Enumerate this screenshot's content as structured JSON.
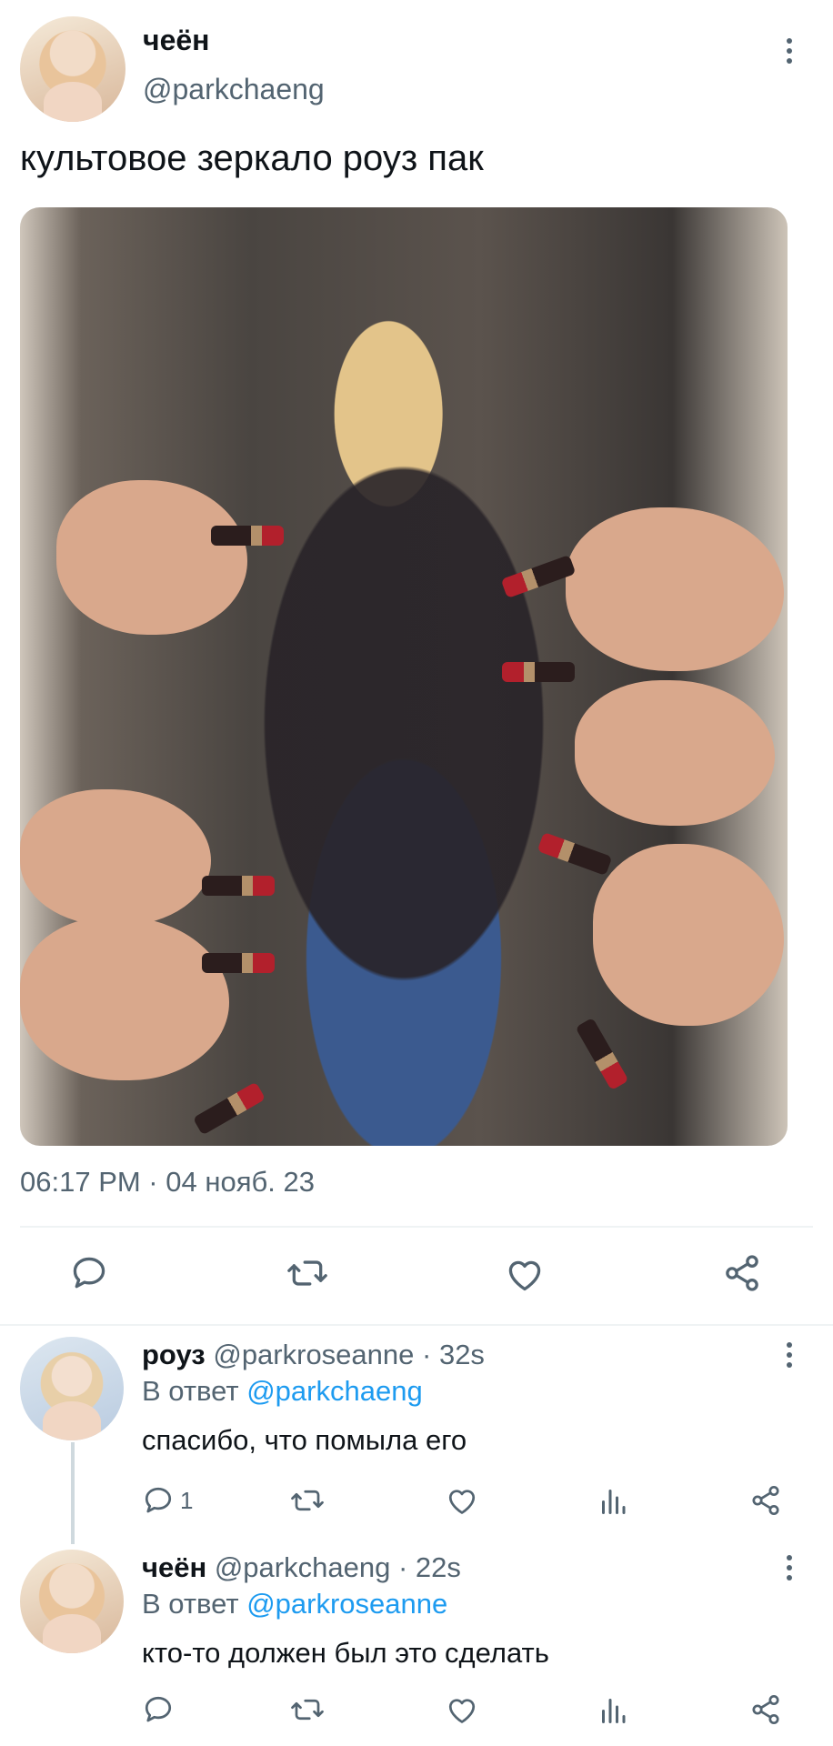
{
  "tweet": {
    "author_name": "чеён",
    "author_handle": "@parkchaeng",
    "text": "культовое зеркало роуз пак",
    "timestamp": "06:17 PM · 04 нояб. 23"
  },
  "replies": [
    {
      "author_name": "роуз",
      "author_handle": "@parkroseanne",
      "age": "· 32s",
      "reply_prefix": "В ответ",
      "reply_to": "@parkchaeng",
      "text": "спасибо, что помыла его",
      "reply_count": "1"
    },
    {
      "author_name": "чеён",
      "author_handle": "@parkchaeng",
      "age": "· 22s",
      "reply_prefix": "В ответ",
      "reply_to": "@parkroseanne",
      "text": "кто-то должен был это сделать",
      "reply_count": ""
    }
  ],
  "icons": {
    "reply": "comment-icon",
    "retweet": "retweet-icon",
    "like": "heart-icon",
    "share": "share-icon",
    "views": "views-icon",
    "menu": "more-vertical-icon"
  },
  "colors": {
    "link": "#1d9bf0",
    "secondary_text": "#536471",
    "divider": "#eff3f4"
  }
}
